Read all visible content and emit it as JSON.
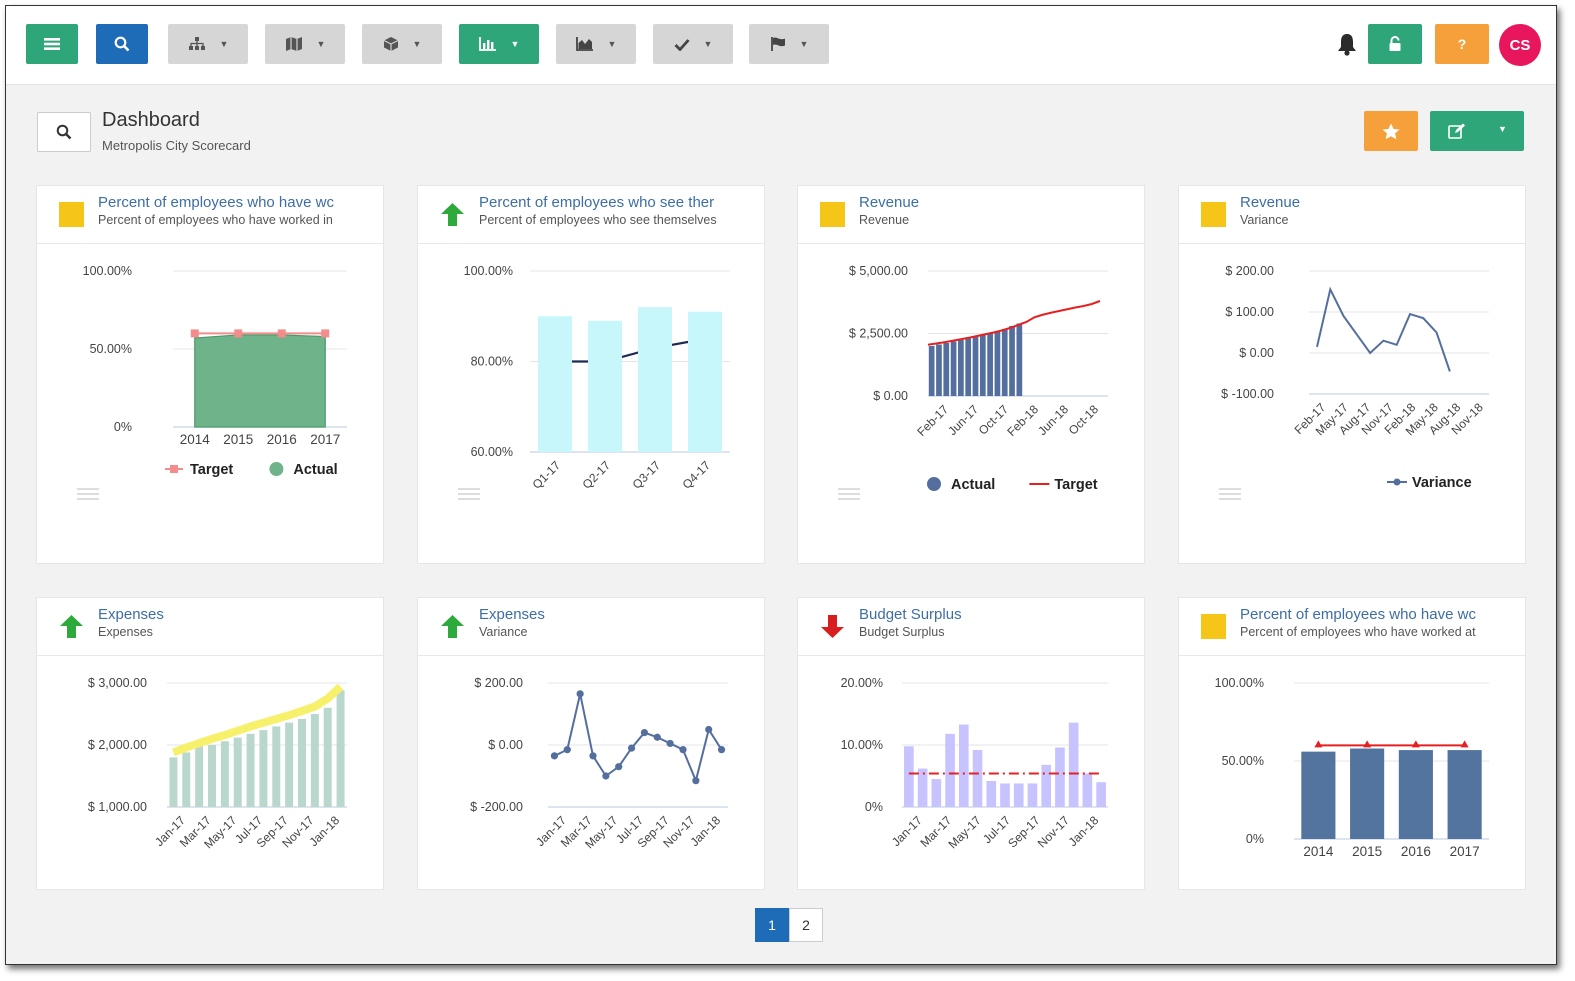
{
  "header": {
    "avatar_initials": "CS",
    "lock_icon": "lock-icon",
    "help_label": "?"
  },
  "page": {
    "title": "Dashboard",
    "subtitle": "Metropolis City Scorecard"
  },
  "pagination": {
    "pages": [
      "1",
      "2"
    ],
    "current": "1"
  },
  "colors": {
    "teal": "#2fa67a",
    "blue": "#1e6bb8",
    "grey": "#d6d6d6",
    "orange": "#f5a03a",
    "pink": "#e8175d"
  },
  "cards": [
    {
      "title": "Percent of employees who have wc",
      "subtitle": "Percent of employees who have worked in",
      "indicator": "yellow-square",
      "chart_data": {
        "type": "area",
        "categories": [
          "2014",
          "2015",
          "2016",
          "2017"
        ],
        "y_ticks": [
          "100.00%",
          "50.00%",
          "0%"
        ],
        "ylim": [
          0,
          100
        ],
        "series": [
          {
            "name": "Target",
            "values": [
              60,
              60,
              60,
              60
            ],
            "color": "#f58c8c"
          },
          {
            "name": "Actual",
            "values": [
              57,
              59,
              59,
              58
            ],
            "color": "#6fb38a"
          }
        ],
        "legend": [
          "Target",
          "Actual"
        ]
      }
    },
    {
      "title": "Percent of employees who see ther",
      "subtitle": "Percent of employees who see themselves",
      "indicator": "green-up-arrow",
      "chart_data": {
        "type": "bar",
        "categories": [
          "Q1-17",
          "Q2-17",
          "Q3-17",
          "Q4-17"
        ],
        "y_ticks": [
          "100.00%",
          "80.00%",
          "60.00%"
        ],
        "ylim": [
          60,
          100
        ],
        "series": [
          {
            "values": [
              90,
              89,
              92,
              91
            ],
            "color": "#c8f7fb"
          },
          {
            "values": [
              80,
              80,
              83,
              85
            ],
            "color": "#1f2a56"
          }
        ],
        "legend": []
      }
    },
    {
      "title": "Revenue",
      "subtitle": "Revenue",
      "indicator": "yellow-square",
      "chart_data": {
        "type": "bar",
        "categories": [
          "Feb-17",
          "Jun-17",
          "Oct-17",
          "Feb-18",
          "Jun-18",
          "Oct-18"
        ],
        "y_ticks": [
          "$ 5,000.00",
          "$ 2,500.00",
          "$ 0.00"
        ],
        "ylim": [
          0,
          5000
        ],
        "series": [
          {
            "name": "Actual",
            "values": [
              2000,
              2060,
              2120,
              2180,
              2240,
              2300,
              2370,
              2440,
              2510,
              2590,
              2680,
              2800,
              2900
            ],
            "color": "#546f9e"
          },
          {
            "name": "Target",
            "values": [
              2050,
              2100,
              2150,
              2210,
              2270,
              2330,
              2400,
              2470,
              2540,
              2620,
              2720,
              2840,
              2960,
              3150,
              3250,
              3330,
              3400,
              3470,
              3540,
              3600,
              3680,
              3800
            ],
            "color": "#e62020"
          }
        ],
        "legend": [
          "Actual",
          "Target"
        ]
      }
    },
    {
      "title": "Revenue",
      "subtitle": "Variance",
      "indicator": "yellow-square",
      "chart_data": {
        "type": "line",
        "categories": [
          "Feb-17",
          "May-17",
          "Aug-17",
          "Nov-17",
          "Feb-18",
          "May-18",
          "Aug-18",
          "Nov-18"
        ],
        "y_ticks": [
          "$ 200.00",
          "$ 100.00",
          "$ 0.00",
          "$ -100.00"
        ],
        "ylim": [
          -100,
          200
        ],
        "series": [
          {
            "name": "Variance",
            "values": [
              15,
              155,
              90,
              45,
              0,
              30,
              20,
              95,
              85,
              50,
              -45
            ],
            "color": "#546f9e"
          }
        ],
        "legend": [
          "Variance"
        ]
      }
    },
    {
      "title": "Expenses",
      "subtitle": "Expenses",
      "indicator": "green-up-arrow",
      "chart_data": {
        "type": "bar",
        "categories": [
          "Jan-17",
          "Mar-17",
          "May-17",
          "Jul-17",
          "Sep-17",
          "Nov-17",
          "Jan-18"
        ],
        "y_ticks": [
          "$ 3,000.00",
          "$ 2,000.00",
          "$ 1,000.00"
        ],
        "ylim": [
          1000,
          3000
        ],
        "series": [
          {
            "values": [
              1800,
              1880,
              1980,
              2000,
              2060,
              2120,
              2180,
              2240,
              2300,
              2360,
              2420,
              2500,
              2600,
              2880
            ],
            "color": "#b9d7cc"
          },
          {
            "values": [
              1880,
              1960,
              2030,
              2100,
              2160,
              2230,
              2300,
              2360,
              2420,
              2480,
              2550,
              2620,
              2750,
              2940
            ],
            "color": "#f7f06a"
          }
        ],
        "legend": []
      }
    },
    {
      "title": "Expenses",
      "subtitle": "Variance",
      "indicator": "green-up-arrow",
      "chart_data": {
        "type": "line",
        "categories": [
          "Jan-17",
          "Mar-17",
          "May-17",
          "Jul-17",
          "Sep-17",
          "Nov-17",
          "Jan-18"
        ],
        "y_ticks": [
          "$ 200.00",
          "$ 0.00",
          "$ -200.00"
        ],
        "ylim": [
          -200,
          200
        ],
        "series": [
          {
            "values": [
              -35,
              -15,
              165,
              -35,
              -100,
              -70,
              -10,
              40,
              25,
              5,
              -15,
              -115,
              50,
              -15
            ],
            "color": "#546f9e"
          }
        ],
        "legend": []
      }
    },
    {
      "title": "Budget Surplus",
      "subtitle": "Budget Surplus",
      "indicator": "red-down-arrow",
      "chart_data": {
        "type": "bar",
        "categories": [
          "Jan-17",
          "Mar-17",
          "May-17",
          "Jul-17",
          "Sep-17",
          "Nov-17",
          "Jan-18"
        ],
        "y_ticks": [
          "20.00%",
          "10.00%",
          "0%"
        ],
        "ylim": [
          0,
          20
        ],
        "series": [
          {
            "values": [
              9.8,
              6.2,
              4.5,
              11.8,
              13.3,
              9.2,
              4.2,
              3.8,
              3.8,
              3.8,
              6.8,
              9.6,
              13.6,
              5.4,
              4.0
            ],
            "color": "#c6c3ff"
          },
          {
            "values": [
              5.4,
              5.4,
              5.4,
              5.4,
              5.4,
              5.4,
              5.4,
              5.4,
              5.4,
              5.4,
              5.4,
              5.4,
              5.4,
              5.4,
              5.4
            ],
            "color": "#e62020"
          }
        ],
        "legend": []
      }
    },
    {
      "title": "Percent of employees who have wc",
      "subtitle": "Percent of employees who have worked at",
      "indicator": "yellow-square",
      "chart_data": {
        "type": "bar",
        "categories": [
          "2014",
          "2015",
          "2016",
          "2017"
        ],
        "y_ticks": [
          "100.00%",
          "50.00%",
          "0%"
        ],
        "ylim": [
          0,
          100
        ],
        "series": [
          {
            "values": [
              56,
              58,
              57,
              57
            ],
            "color": "#5474a0"
          },
          {
            "values": [
              60,
              60,
              60,
              60
            ],
            "color": "#e62020"
          }
        ],
        "legend": []
      }
    }
  ]
}
